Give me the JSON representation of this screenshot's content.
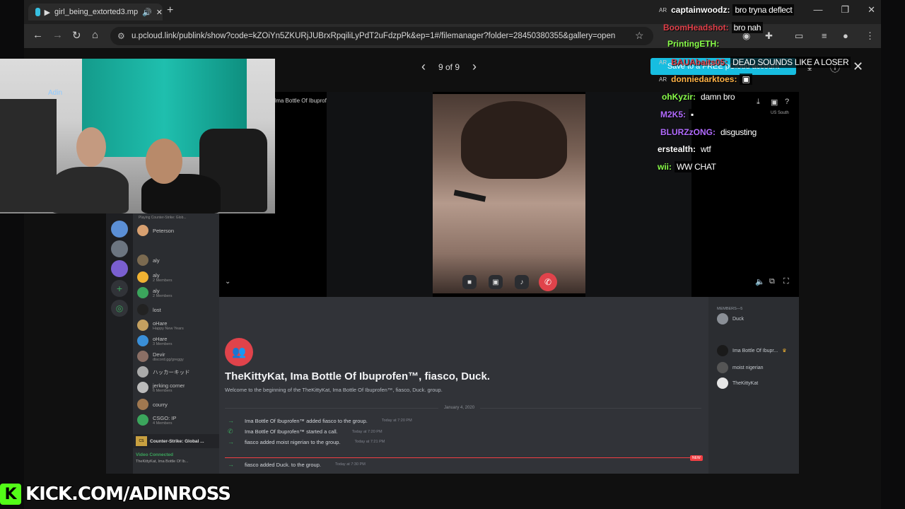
{
  "browser": {
    "tab_title": "girl_being_extorted3.mp",
    "new_tab": "+",
    "window_controls": [
      "—",
      "❐",
      "✕"
    ],
    "url": "u.pcloud.link/publink/show?code=kZOiYn5ZKURjJUBrxRpqiliLyPdT2uFdzpPk&ep=1#/filemanager?folder=28450380355&gallery=open"
  },
  "viewer": {
    "counter": "9 of 9",
    "prev": "‹",
    "next": "›",
    "save_button": "Save to a FREE pCloud account",
    "close": "✕"
  },
  "discord": {
    "call_header": "Ima Bottle Of Ibuprofen™, fiasco, Duck.",
    "region": "US South",
    "dm_list": [
      {
        "name": "Peterson",
        "sub": ""
      },
      {
        "name": "aly",
        "sub": ""
      },
      {
        "name": "aly",
        "sub": "2 Members"
      },
      {
        "name": "aly",
        "sub": "2 Members"
      },
      {
        "name": "lost",
        "sub": ""
      },
      {
        "name": "oHare",
        "sub": "Happy New Years"
      },
      {
        "name": "oHare",
        "sub": "3 Members"
      },
      {
        "name": "Devir",
        "sub": "discord.gg/greggy"
      },
      {
        "name": "ハッカーキッド",
        "sub": ""
      },
      {
        "name": "jerking corner",
        "sub": "6 Members"
      },
      {
        "name": "courry",
        "sub": ""
      },
      {
        "name": "CSGO: IP",
        "sub": "4 Members"
      }
    ],
    "playing_status": "Playing Counter-Strike: Glob...",
    "now_playing": "Counter-Strike: Global ...",
    "voice_status": "Video Connected",
    "voice_channel": "TheKittyKat, Ima Bottle Of Ib...",
    "group_title": "TheKittyKat, Ima Bottle Of Ibuprofen™, fiasco, Duck.",
    "group_welcome": "Welcome to the beginning of the TheKittyKat, Ima Bottle Of Ibuprofen™, fiasco, Duck. group.",
    "date_separator": "January 4, 2020",
    "messages": [
      {
        "text": "Ima Bottle Of Ibuprofen™ added fiasco to the group.",
        "time": "Today at 7:20 PM",
        "icon": "→"
      },
      {
        "text": "Ima Bottle Of Ibuprofen™ started a call.",
        "time": "Today at 7:20 PM",
        "icon": "✆"
      },
      {
        "text": "fiasco added moist nigerian to the group.",
        "time": "Today at 7:21 PM",
        "icon": "→"
      },
      {
        "text": "fiasco added Duck. to the group.",
        "time": "Today at 7:30 PM",
        "icon": "→"
      }
    ],
    "new_badge": "NEW",
    "members_header": "MEMBERS—5",
    "members": [
      "Duck",
      "Ima Bottle Of Ibupr...",
      "moist nigerian",
      "TheKittyKat"
    ]
  },
  "webcam": {
    "neon_sign": "Adin"
  },
  "stream_chat": [
    {
      "badge": "AR",
      "user": "captainwoodz:",
      "msg": "bro tryna deflect",
      "color": "#ffffff"
    },
    {
      "badge": "",
      "user": "BoomHeadshot:",
      "msg": "bro nah",
      "color": "#e0404a"
    },
    {
      "badge": "",
      "user": "PrintingETH:",
      "msg": "",
      "color": "#8aff4a"
    },
    {
      "badge": "AR",
      "user": "BAUAbaits05:",
      "msg": "DEAD SOUNDS LIKE A LOSER",
      "color": "#e0404a"
    },
    {
      "badge": "AR",
      "user": "donniedarktoes:",
      "msg": "",
      "color": "#ffb347"
    },
    {
      "badge": "",
      "user": "ohKyzir:",
      "msg": "damn bro",
      "color": "#8aff4a"
    },
    {
      "badge": "",
      "user": "M2K5:",
      "msg": "",
      "color": "#b26bff"
    },
    {
      "badge": "",
      "user": "BLURZzONG:",
      "msg": "disgusting",
      "color": "#b26bff"
    },
    {
      "badge": "",
      "user": "erstealth:",
      "msg": "wtf",
      "color": "#ffffff"
    },
    {
      "badge": "",
      "user": "wii:",
      "msg": "WW CHAT",
      "color": "#8aff4a"
    }
  ],
  "kick": {
    "logo": "K",
    "url": "KICK.COM/ADINROSS"
  }
}
